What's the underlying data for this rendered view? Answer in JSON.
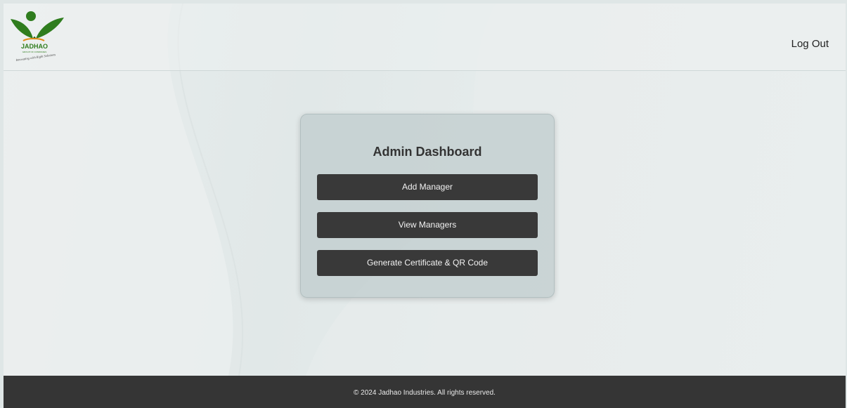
{
  "brand": {
    "logo_text": "JADHAO",
    "logo_subtext": "GROUP OF COMPANIES",
    "logo_tagline": "Innovating with Right Solutions",
    "leaf_color": "#2f7d1e",
    "dot_color": "#2f7d1e",
    "text_color": "#e08a14"
  },
  "header": {
    "logout_label": "Log Out"
  },
  "dashboard": {
    "title": "Admin Dashboard",
    "buttons": [
      {
        "label": "Add Manager"
      },
      {
        "label": "View Managers"
      },
      {
        "label": "Generate Certificate & QR Code"
      }
    ]
  },
  "footer": {
    "copyright": "© 2024 Jadhao Industries. All rights reserved."
  }
}
